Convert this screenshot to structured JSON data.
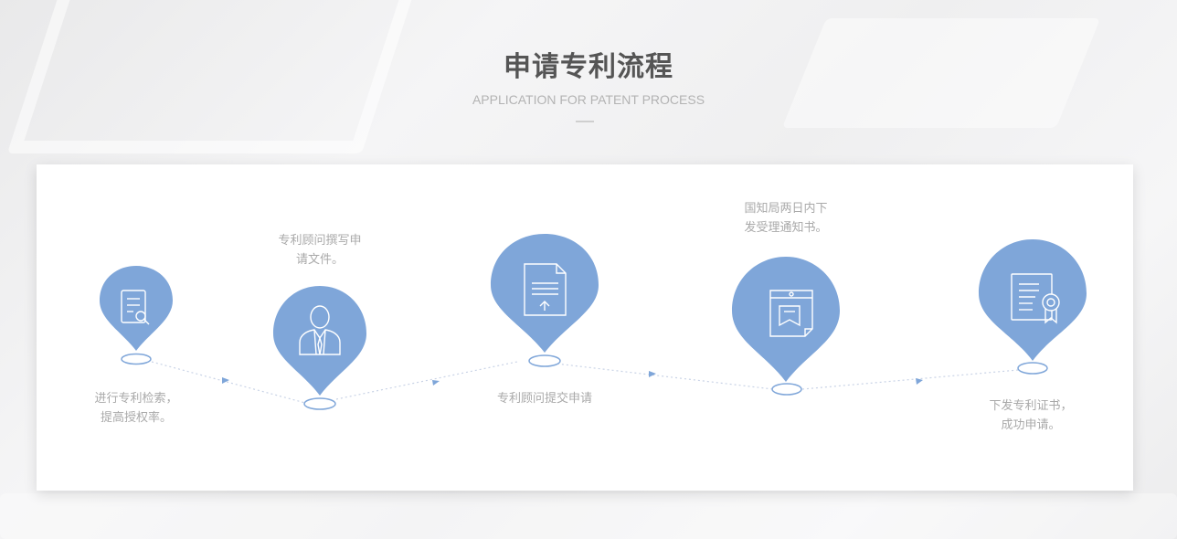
{
  "header": {
    "title": "申请专利流程",
    "subtitle": "APPLICATION FOR PATENT PROCESS"
  },
  "theme": {
    "pin_color": "#7fa6d9",
    "connector_color": "#c9d3e6",
    "arrow_color": "#7fa6d9",
    "text_color": "#a9a9a9"
  },
  "steps": [
    {
      "icon": "document-search-icon",
      "text": "进行专利检索，\n提高授权率。"
    },
    {
      "icon": "consultant-person-icon",
      "text": "专利顾问撰写申\n请文件。"
    },
    {
      "icon": "document-upload-icon",
      "text": "专利顾问提交申请"
    },
    {
      "icon": "calendar-notice-icon",
      "text": "国知局两日内下\n发受理通知书。"
    },
    {
      "icon": "certificate-icon",
      "text": "下发专利证书，\n成功申请。"
    }
  ]
}
